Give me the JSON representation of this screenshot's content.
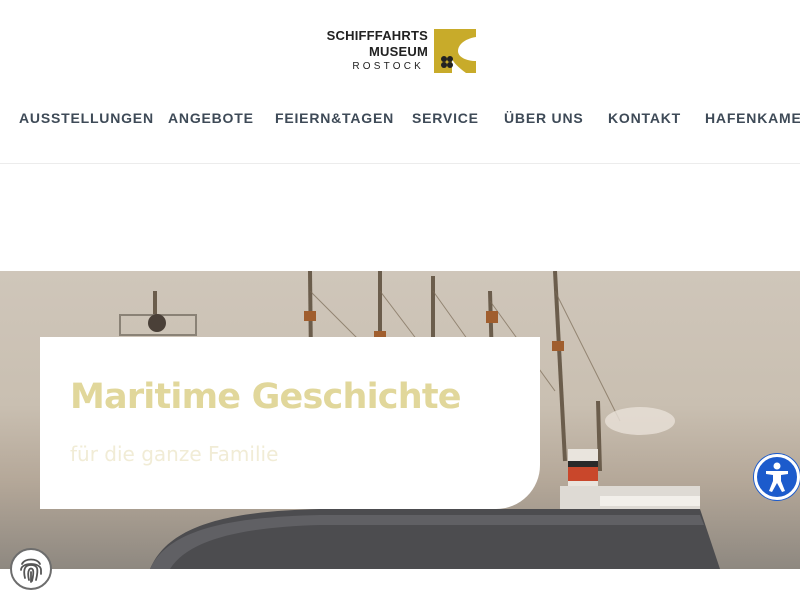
{
  "logo": {
    "line1": "SCHIFFFAHRTS",
    "line2": "MUSEUM",
    "line3": "ROSTOCK",
    "colors": {
      "gold": "#c8ab2a",
      "dark": "#222222"
    }
  },
  "nav": {
    "items": [
      {
        "label": "AUSSTELLUNGEN"
      },
      {
        "label": "ANGEBOTE"
      },
      {
        "label": "FEIERN&TAGEN"
      },
      {
        "label": "SERVICE"
      },
      {
        "label": "ÜBER UNS"
      },
      {
        "label": "KONTAKT"
      },
      {
        "label": "HAFENKAMERA"
      }
    ],
    "text_color": "#3e4a57"
  },
  "hero": {
    "title": "Maritime Geschichte",
    "subtitle": "für die ganze Familie",
    "title_color": "#e1d79b"
  },
  "widgets": {
    "accessibility_icon": "accessibility-person-icon",
    "fingerprint_icon": "fingerprint-icon",
    "accessibility_color": "#1c5bcc"
  }
}
